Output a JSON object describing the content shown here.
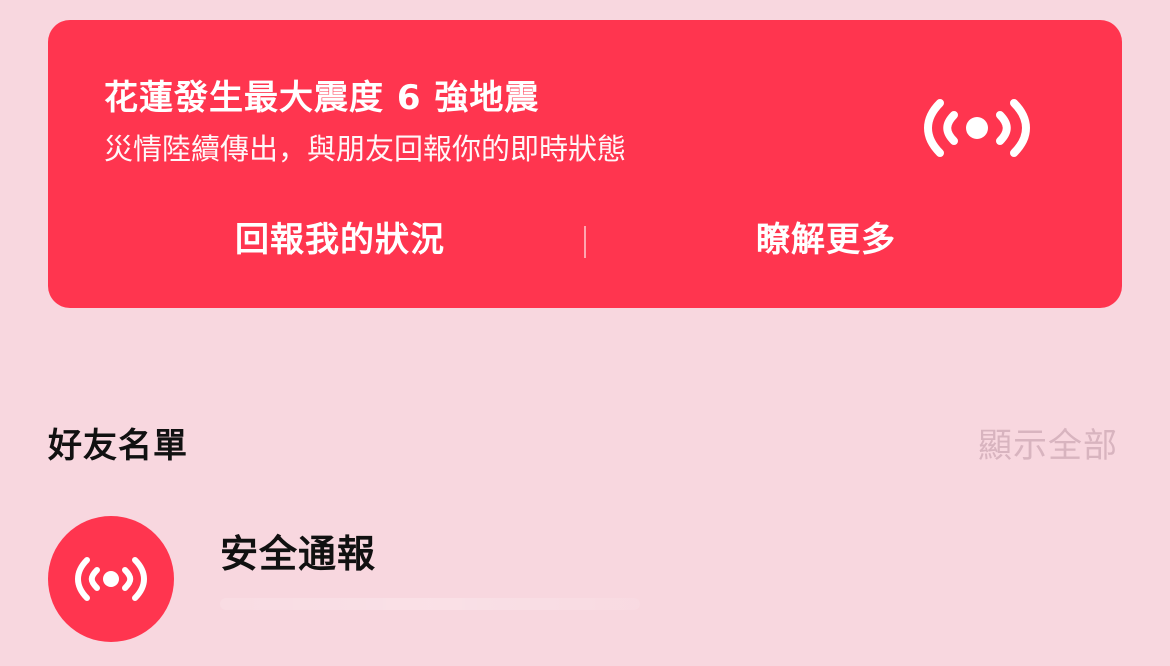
{
  "alert": {
    "title": "花蓮發生最大震度 6 強地震",
    "subtitle": "災情陸續傳出，與朋友回報你的即時狀態",
    "icon": "broadcast-icon",
    "actions": {
      "report": "回報我的狀況",
      "learn_more": "瞭解更多"
    },
    "colors": {
      "card": "#ff354f",
      "text": "#ffffff"
    }
  },
  "friends": {
    "title": "好友名單",
    "show_all": "顯示全部",
    "items": [
      {
        "name": "安全通報",
        "icon": "broadcast-icon",
        "avatar_color": "#ff354f"
      }
    ]
  },
  "theme": {
    "background": "#f8d7df",
    "muted_text": "#d8b4bf",
    "primary_text": "#111111"
  }
}
